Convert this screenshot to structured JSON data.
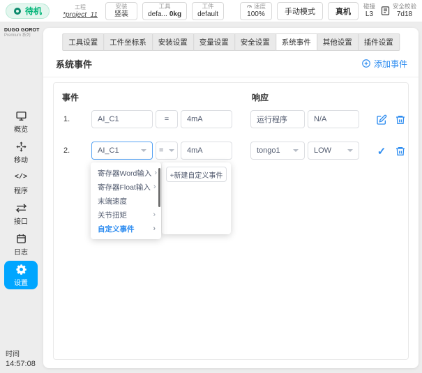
{
  "topbar": {
    "status": "待机",
    "project": {
      "label": "工程",
      "value": "*project_11"
    },
    "install": {
      "label": "安装",
      "value": "竖装"
    },
    "tool": {
      "label": "工具",
      "value": "defa...",
      "weight": "0kg"
    },
    "workpiece": {
      "label": "工件",
      "value": "default"
    },
    "speed": {
      "label": "速度",
      "value": "100%"
    },
    "manual_mode_label": "手动模式",
    "real_machine_label": "真机",
    "collision": {
      "label": "碰撞",
      "value": "L3"
    },
    "safety": {
      "label": "安全校验",
      "value": "7d18"
    }
  },
  "sidebar": {
    "logo_title": "DUGO GOROT",
    "logo_subtitle": "Premium 系列",
    "items": [
      {
        "label": "概览"
      },
      {
        "label": "移动"
      },
      {
        "label": "程序"
      },
      {
        "label": "接口"
      },
      {
        "label": "日志"
      },
      {
        "label": "设置"
      }
    ],
    "time": {
      "label": "时间",
      "value": "14:57:08"
    }
  },
  "tabs": [
    "工具设置",
    "工件坐标系",
    "安装设置",
    "变量设置",
    "安全设置",
    "系统事件",
    "其他设置",
    "插件设置"
  ],
  "content": {
    "title": "系统事件",
    "add_event_label": "添加事件",
    "columns": {
      "event": "事件",
      "response": "响应"
    },
    "rows": [
      {
        "index": "1.",
        "event_source": "AI_C1",
        "operator": "=",
        "value": "4mA",
        "response_action": "运行程序",
        "response_param": "N/A"
      },
      {
        "index": "2.",
        "event_source": "AI_C1",
        "operator": "=",
        "value": "4mA",
        "response_action": "tongo1",
        "response_param": "LOW"
      }
    ],
    "dropdown": {
      "items": [
        {
          "label": "寄存器Word输入"
        },
        {
          "label": "寄存器Float输入"
        },
        {
          "label": "末端速度"
        },
        {
          "label": "关节扭矩"
        },
        {
          "label": "自定义事件"
        }
      ],
      "new_custom_event_label": "+新建自定义事件"
    }
  },
  "icons": {
    "chevron_right": "›",
    "check": "✓",
    "code": "</>"
  },
  "colors": {
    "accent_blue": "#2d8cf0",
    "sidebar_active_blue": "#00a6ff",
    "status_green": "#00b578"
  }
}
